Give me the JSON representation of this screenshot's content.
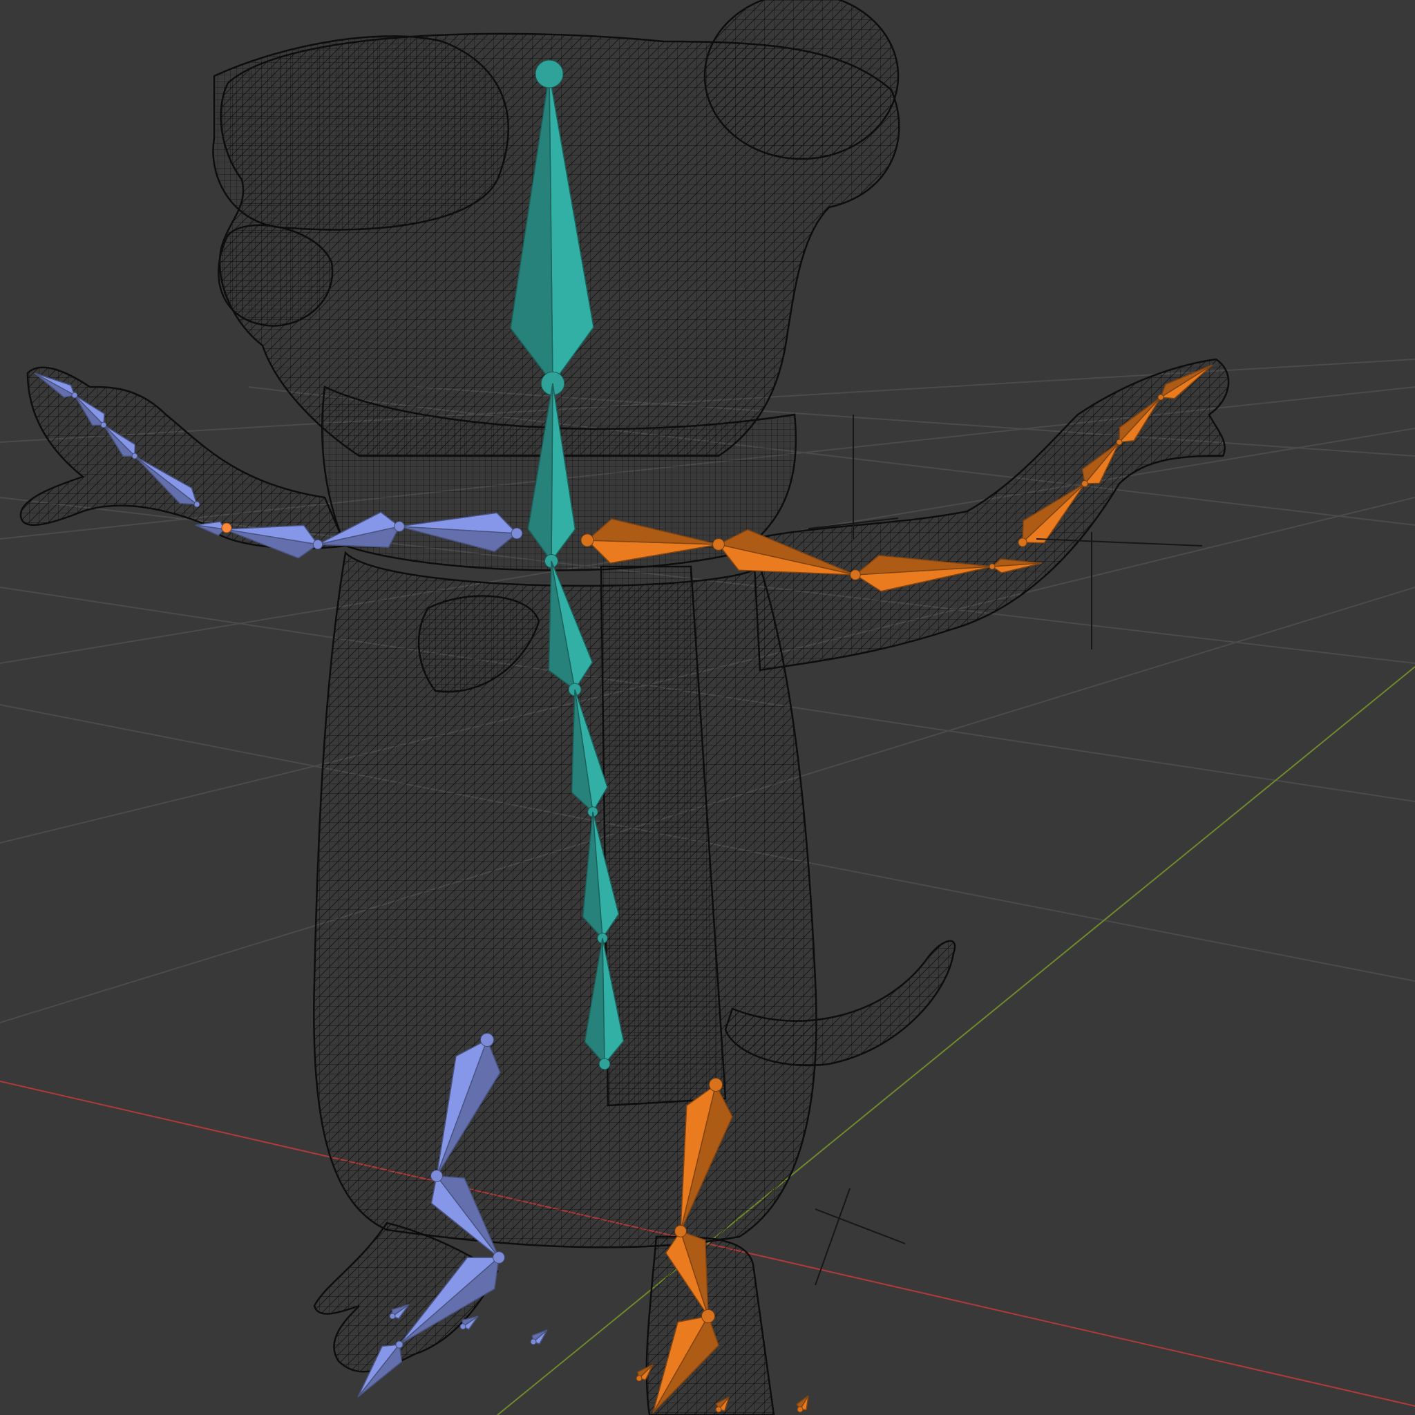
{
  "viewport": {
    "mode": "wireframe",
    "background_color": "#393939",
    "grid_color": "#4a4a4a",
    "x_axis_color": "#b03a3a",
    "y_axis_color": "#6f8a2a",
    "wire_color": "#111111"
  },
  "rig": {
    "spine_color": "#2fa39a",
    "left_side_color": "#7c8cd8",
    "right_side_color": "#d9721c",
    "selected_outline_color": "#ff8a3a"
  },
  "object": {
    "icon": "armature-icon",
    "mesh_icon": "mesh-wireframe-icon"
  }
}
